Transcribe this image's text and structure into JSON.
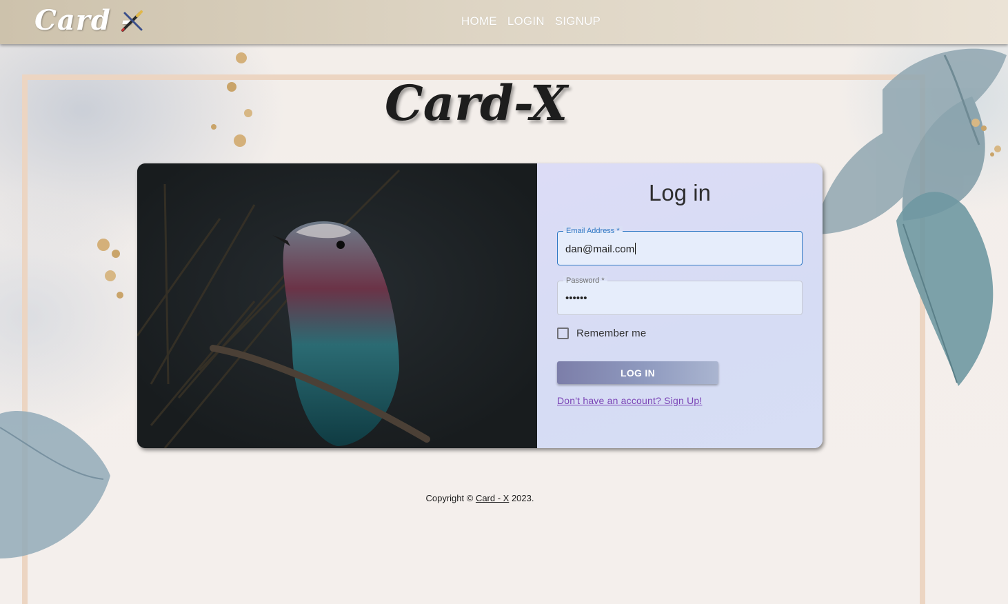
{
  "brand": {
    "logo_text": "Card -",
    "title": "Card-X"
  },
  "nav": {
    "items": [
      "HOME",
      "LOGIN",
      "SIGNUP"
    ]
  },
  "login": {
    "heading": "Log in",
    "email": {
      "label": "Email Address *",
      "value": "dan@mail.com"
    },
    "password": {
      "label": "Password *",
      "value": "••••••"
    },
    "remember_label": "Remember me",
    "submit_label": "LOG IN",
    "signup_link": "Don't have an account? Sign Up!"
  },
  "footer": {
    "prefix": "Copyright © ",
    "link": "Card - X",
    "suffix": " 2023."
  },
  "colors": {
    "accent": "#2f78c4",
    "button": "#8f9abf",
    "link": "#7a43b6"
  }
}
